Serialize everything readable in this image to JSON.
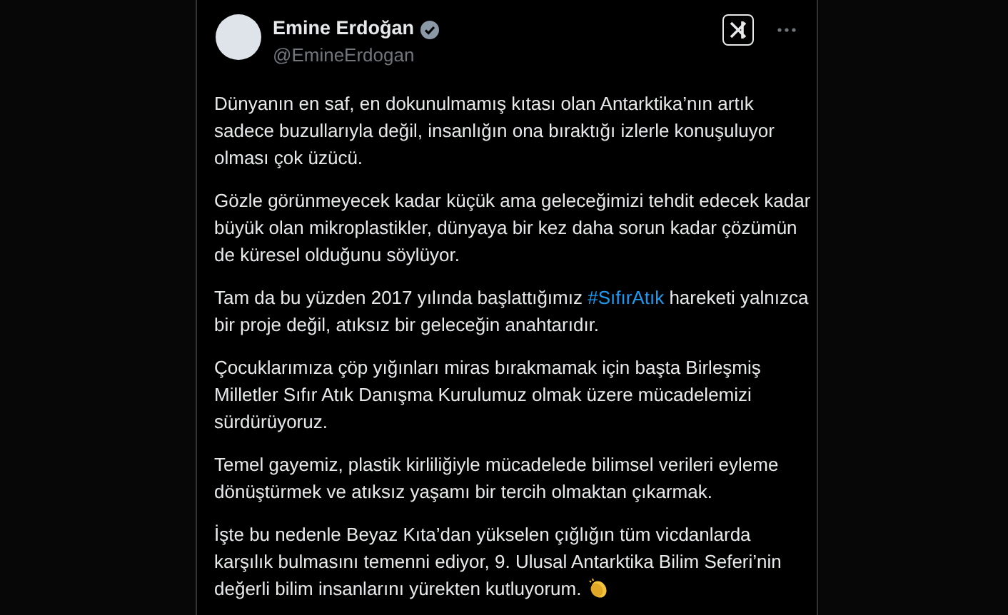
{
  "author": {
    "name": "Emine Erdoğan",
    "handle": "@EmineErdogan",
    "verified": true
  },
  "paragraphs": [
    {
      "parts": [
        {
          "kind": "text",
          "text": "Dünyanın en saf, en dokunulmamış kıtası olan Antarktika’nın artık sadece buzullarıyla değil, insanlığın ona bıraktığı izlerle konuşuluyor olması çok üzücü."
        }
      ]
    },
    {
      "parts": [
        {
          "kind": "text",
          "text": "Gözle görünmeyecek kadar küçük ama geleceğimizi tehdit edecek kadar büyük olan mikroplastikler, dünyaya bir kez daha sorun kadar çözümün de küresel olduğunu söylüyor."
        }
      ]
    },
    {
      "parts": [
        {
          "kind": "text",
          "text": "Tam da bu yüzden 2017 yılında başlattığımız "
        },
        {
          "kind": "hashtag",
          "text": "#SıfırAtık"
        },
        {
          "kind": "text",
          "text": " hareketi yalnızca bir proje değil, atıksız bir geleceğin anahtarıdır."
        }
      ]
    },
    {
      "parts": [
        {
          "kind": "text",
          "text": "Çocuklarımıza çöp yığınları miras bırakmamak için başta Birleşmiş Milletler Sıfır Atık Danışma Kurulumuz olmak üzere mücadelemizi sürdürüyoruz."
        }
      ]
    },
    {
      "parts": [
        {
          "kind": "text",
          "text": "Temel gayemiz, plastik kirliliğiyle mücadelede bilimsel verileri eyleme dönüştürmek ve atıksız yaşamı bir tercih olmaktan çıkarmak."
        }
      ]
    },
    {
      "parts": [
        {
          "kind": "text",
          "text": "İşte bu nedenle Beyaz Kıta’dan yükselen çığlığın tüm vicdanlarda karşılık bulmasını temenni ediyor, 9. Ulusal Antarktika Bilim Seferi’nin değerli bilim insanlarını yürekten kutluyorum."
        }
      ]
    }
  ]
}
